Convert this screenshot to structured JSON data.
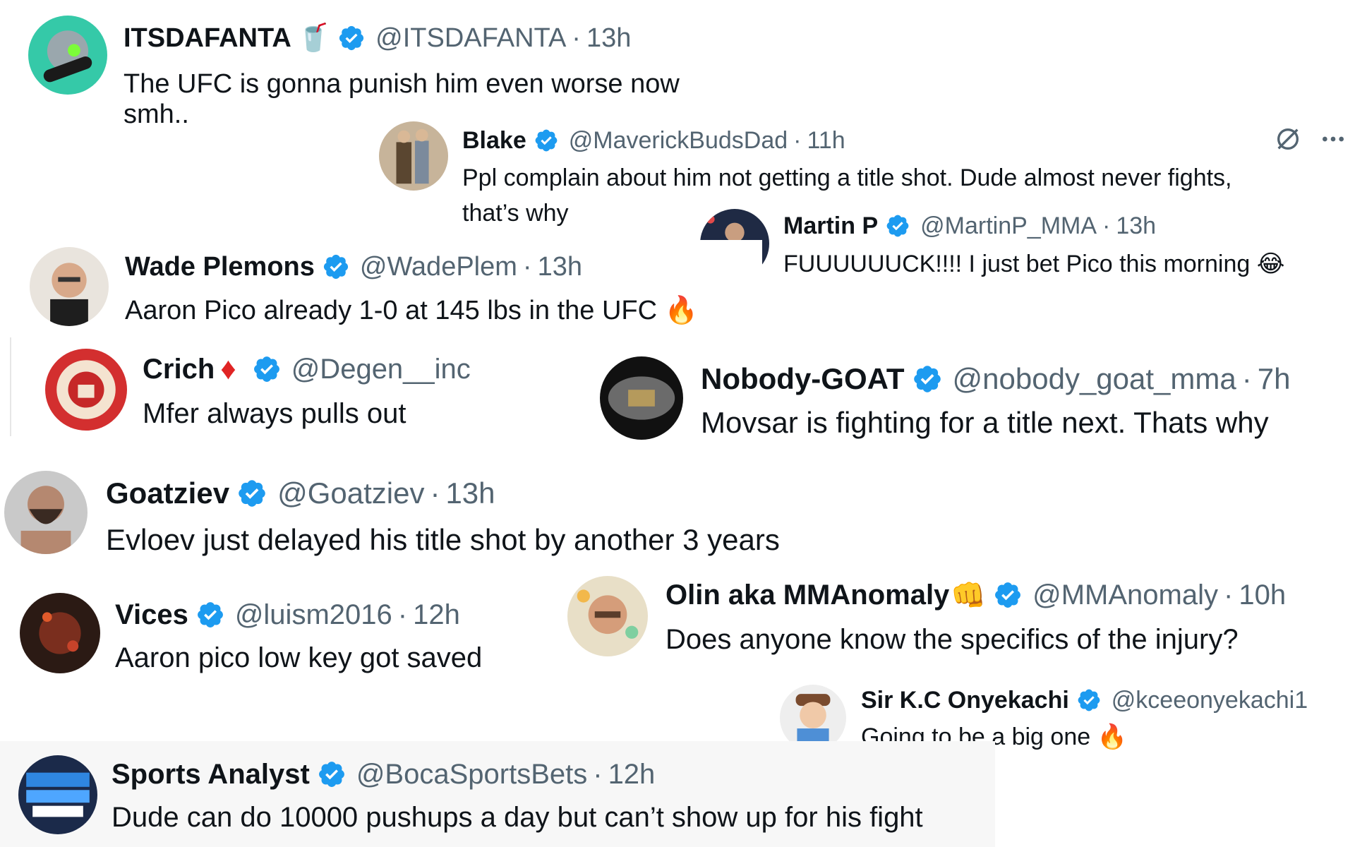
{
  "tweets": [
    {
      "name": "ITSDAFANTA",
      "name_emoji": "🥤",
      "handle": "@ITSDAFANTA",
      "time": "13h",
      "text": "The UFC is gonna punish him even worse now smh.."
    },
    {
      "name": "Blake",
      "handle": "@MaverickBudsDad",
      "time": "11h",
      "text": "Ppl complain about him not getting a title shot. Dude almost never fights, that’s why"
    },
    {
      "name": "Martin P",
      "handle": "@MartinP_MMA",
      "time": "13h",
      "text": "FUUUUUUCK!!!! I just bet Pico this morning",
      "text_emoji": "😂"
    },
    {
      "name": "Wade Plemons",
      "handle": "@WadePlem",
      "time": "13h",
      "text": "Aaron Pico already 1-0 at 145 lbs in the UFC",
      "text_emoji": "🔥"
    },
    {
      "name": "Crich",
      "name_emoji": "♦",
      "handle": "@Degen__inc",
      "time": "",
      "text": "Mfer always pulls out"
    },
    {
      "name": "Nobody-GOAT",
      "handle": "@nobody_goat_mma",
      "time": "7h",
      "text": "Movsar is fighting for a title next. Thats why"
    },
    {
      "name": "Goatziev",
      "handle": "@Goatziev",
      "time": "13h",
      "text": "Evloev just delayed his title shot by another 3 years"
    },
    {
      "name": "Vices",
      "handle": "@luism2016",
      "time": "12h",
      "text": "Aaron pico low key got saved"
    },
    {
      "name": "Olin aka MMAnomaly",
      "name_emoji": "👊",
      "handle": "@MMAnomaly",
      "time": "10h",
      "text": "Does anyone know the specifics of the injury?"
    },
    {
      "name": "Sir K.C Onyekachi",
      "handle": "@kceeonyekachi1",
      "time": "",
      "text": "Going to be a big one",
      "text_emoji": "🔥"
    },
    {
      "name": "Sports Analyst",
      "handle": "@BocaSportsBets",
      "time": "12h",
      "text": "Dude can do 10000 pushups a day but can’t show up for his fight"
    }
  ],
  "separator": "·",
  "colors": {
    "verified": "#1d9bf0",
    "text": "#0f1419",
    "muted": "#536471",
    "crich_diamond": "#e02424"
  },
  "icons": [
    "verified-badge-icon",
    "grok-icon",
    "more-icon"
  ]
}
